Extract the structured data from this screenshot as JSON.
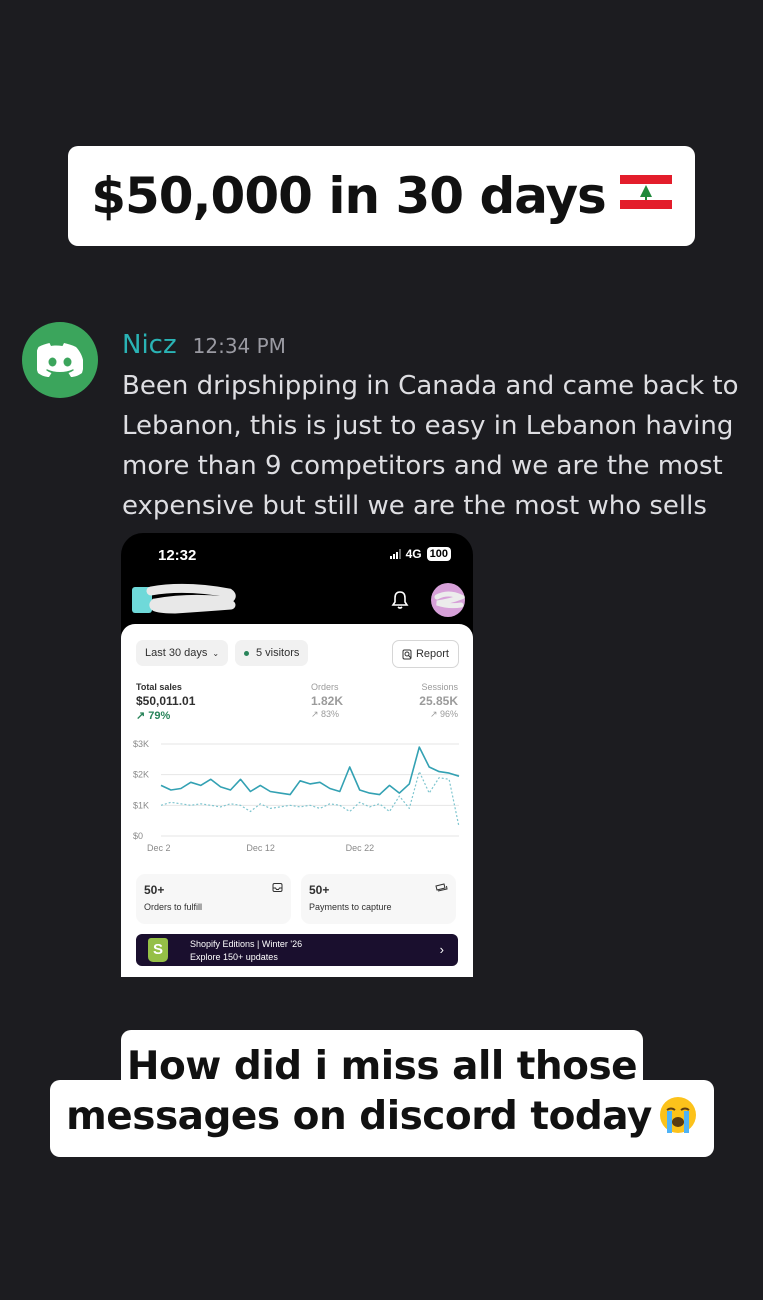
{
  "headline": {
    "text": "$50,000 in 30 days",
    "flag_icon": "lebanon-flag-icon"
  },
  "message": {
    "avatar_icon": "discord-logo-icon",
    "username": "Nicz",
    "timestamp": "12:34 PM",
    "body": "Been dripshipping in Canada and came back to Lebanon, this is just to easy in Lebanon having more than 9 competitors and we are the most expensive but still we are the most who sells"
  },
  "phone": {
    "status_time": "12:32",
    "network": "4G",
    "battery": "100",
    "date_filter": "Last 30 days",
    "visitors": "5 visitors",
    "report_label": "Report",
    "metrics": {
      "sales": {
        "label": "Total sales",
        "value": "$50,011.01",
        "change": "↗ 79%"
      },
      "orders": {
        "label": "Orders",
        "value": "1.82K",
        "change": "↗ 83%"
      },
      "sessions": {
        "label": "Sessions",
        "value": "25.85K",
        "change": "↗ 96%"
      }
    },
    "cards": [
      {
        "value": "50+",
        "label": "Orders to fulfill"
      },
      {
        "value": "50+",
        "label": "Payments to capture"
      }
    ],
    "banner": {
      "line1": "Shopify Editions | Winter '26",
      "line2": "Explore 150+ updates",
      "arrow": "›"
    }
  },
  "chart_data": {
    "type": "line",
    "y_ticks": [
      "$3K",
      "$2K",
      "$1K",
      "$0"
    ],
    "x_ticks": [
      "Dec 2",
      "Dec 12",
      "Dec 22"
    ],
    "ylim": [
      0,
      3000
    ],
    "x": [
      1,
      2,
      3,
      4,
      5,
      6,
      7,
      8,
      9,
      10,
      11,
      12,
      13,
      14,
      15,
      16,
      17,
      18,
      19,
      20,
      21,
      22,
      23,
      24,
      25,
      26,
      27,
      28,
      29,
      30,
      31
    ],
    "series": [
      {
        "values": [
          1650,
          1500,
          1550,
          1750,
          1650,
          1850,
          1600,
          1500,
          1850,
          1450,
          1650,
          1450,
          1400,
          1350,
          1800,
          1700,
          1750,
          1550,
          1450,
          2250,
          1500,
          1400,
          1350,
          1650,
          1400,
          1700,
          2900,
          2250,
          2100,
          2050,
          1950
        ]
      },
      {
        "values": [
          1000,
          1100,
          1050,
          1000,
          1050,
          1000,
          950,
          1050,
          1000,
          800,
          1050,
          900,
          950,
          1000,
          950,
          1000,
          900,
          1050,
          1000,
          800,
          1100,
          950,
          1050,
          800,
          1300,
          900,
          2100,
          1400,
          1900,
          1850,
          300
        ]
      }
    ]
  },
  "caption": {
    "line1": "How did i miss all those",
    "line2": "messages on discord today",
    "emoji_icon": "loudly-crying-face-icon"
  },
  "colors": {
    "background": "#1c1c20",
    "discord_green": "#3ba55c",
    "username": "#2ab3b5",
    "sales_line": "#33a1b3",
    "compare_line": "#7ec5cf",
    "positive": "#29845a"
  }
}
